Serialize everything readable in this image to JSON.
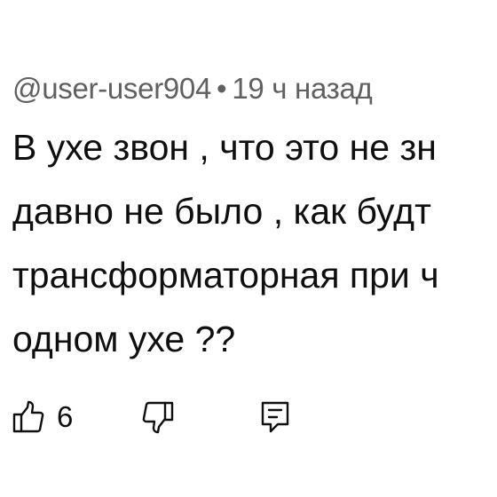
{
  "comment": {
    "author": "@user-user904",
    "separator": "•",
    "time_ago": "19 ч назад",
    "text_lines": [
      "В ухе звон , что это не зн",
      "давно не было , как будт",
      "трансформаторная при ч",
      "одном ухе ??"
    ],
    "likes": "6"
  },
  "icons": {
    "like": "thumbs-up-icon",
    "dislike": "thumbs-down-icon",
    "reply": "reply-comment-icon"
  },
  "colors": {
    "text": "#0f0f0f",
    "meta": "#606060",
    "background": "#ffffff"
  }
}
